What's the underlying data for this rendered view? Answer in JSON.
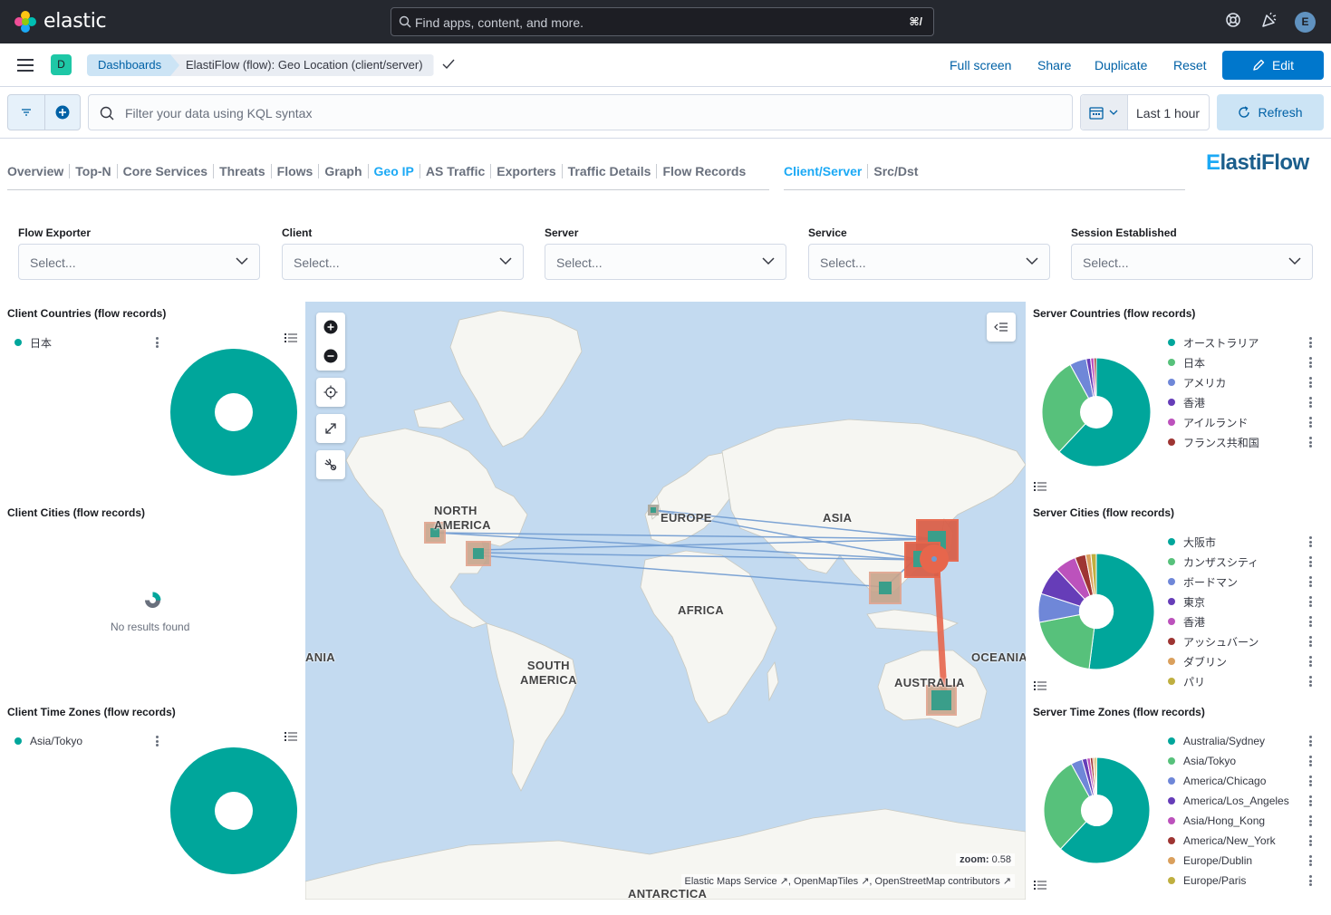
{
  "header": {
    "brand": "elastic",
    "search_placeholder": "Find apps, content, and more.",
    "search_shortcut": "⌘/",
    "avatar_initial": "E"
  },
  "navbar": {
    "space_initial": "D",
    "breadcrumbs": [
      "Dashboards",
      "ElastiFlow (flow): Geo Location (client/server)"
    ],
    "links": [
      "Full screen",
      "Share",
      "Duplicate",
      "Reset"
    ],
    "edit_label": "Edit"
  },
  "querybar": {
    "kql_placeholder": "Filter your data using KQL syntax",
    "time_range": "Last 1 hour",
    "refresh_label": "Refresh"
  },
  "dashboard_tabs": {
    "left": [
      "Overview",
      "Top-N",
      "Core Services",
      "Threats",
      "Flows",
      "Graph",
      "Geo IP",
      "AS Traffic",
      "Exporters",
      "Traffic Details",
      "Flow Records"
    ],
    "left_active": "Geo IP",
    "right": [
      "Client/Server",
      "Src/Dst"
    ],
    "right_active": "Client/Server",
    "logo": "ElastiFlow"
  },
  "controls": [
    {
      "label": "Flow Exporter",
      "placeholder": "Select..."
    },
    {
      "label": "Client",
      "placeholder": "Select..."
    },
    {
      "label": "Server",
      "placeholder": "Select..."
    },
    {
      "label": "Service",
      "placeholder": "Select..."
    },
    {
      "label": "Session Established",
      "placeholder": "Select..."
    }
  ],
  "panels": {
    "client_countries": {
      "title": "Client Countries (flow records)",
      "legend": [
        "日本"
      ]
    },
    "client_cities": {
      "title": "Client Cities (flow records)",
      "empty": "No results found"
    },
    "client_timezones": {
      "title": "Client Time Zones (flow records)",
      "legend": [
        "Asia/Tokyo"
      ]
    },
    "server_countries": {
      "title": "Server Countries (flow records)",
      "legend": [
        "オーストラリア",
        "日本",
        "アメリカ",
        "香港",
        "アイルランド",
        "フランス共和国"
      ]
    },
    "server_cities": {
      "title": "Server Cities (flow records)",
      "legend": [
        "大阪市",
        "カンザスシティ",
        "ボードマン",
        "東京",
        "香港",
        "アッシュバーン",
        "ダブリン",
        "パリ"
      ]
    },
    "server_timezones": {
      "title": "Server Time Zones (flow records)",
      "legend": [
        "Australia/Sydney",
        "Asia/Tokyo",
        "America/Chicago",
        "America/Los_Angeles",
        "Asia/Hong_Kong",
        "America/New_York",
        "Europe/Dublin",
        "Europe/Paris"
      ]
    }
  },
  "palette": [
    "#00a69b",
    "#57c17b",
    "#6f87d8",
    "#663db8",
    "#bc52bc",
    "#9e3533",
    "#daa05d",
    "#bfaf40"
  ],
  "pies": {
    "client_countries": [
      100
    ],
    "client_timezones": [
      100
    ],
    "server_countries": [
      62,
      30,
      5,
      1.3,
      1,
      0.7
    ],
    "server_cities": [
      52,
      20,
      8,
      8,
      6,
      3,
      1.5,
      1.5
    ],
    "server_timezones": [
      62,
      30,
      3.5,
      1.5,
      1,
      0.8,
      0.6,
      0.6
    ]
  },
  "map": {
    "labels": [
      "NORTH AMERICA",
      "EUROPE",
      "ASIA",
      "AFRICA",
      "SOUTH AMERICA",
      "AUSTRALIA",
      "OCEANIA",
      "ANIA",
      "ANTARCTICA"
    ],
    "zoom_label": "zoom:",
    "zoom_value": "0.58",
    "attribution": [
      "Elastic Maps Service",
      "OpenMapTiles",
      "OpenStreetMap contributors"
    ]
  }
}
